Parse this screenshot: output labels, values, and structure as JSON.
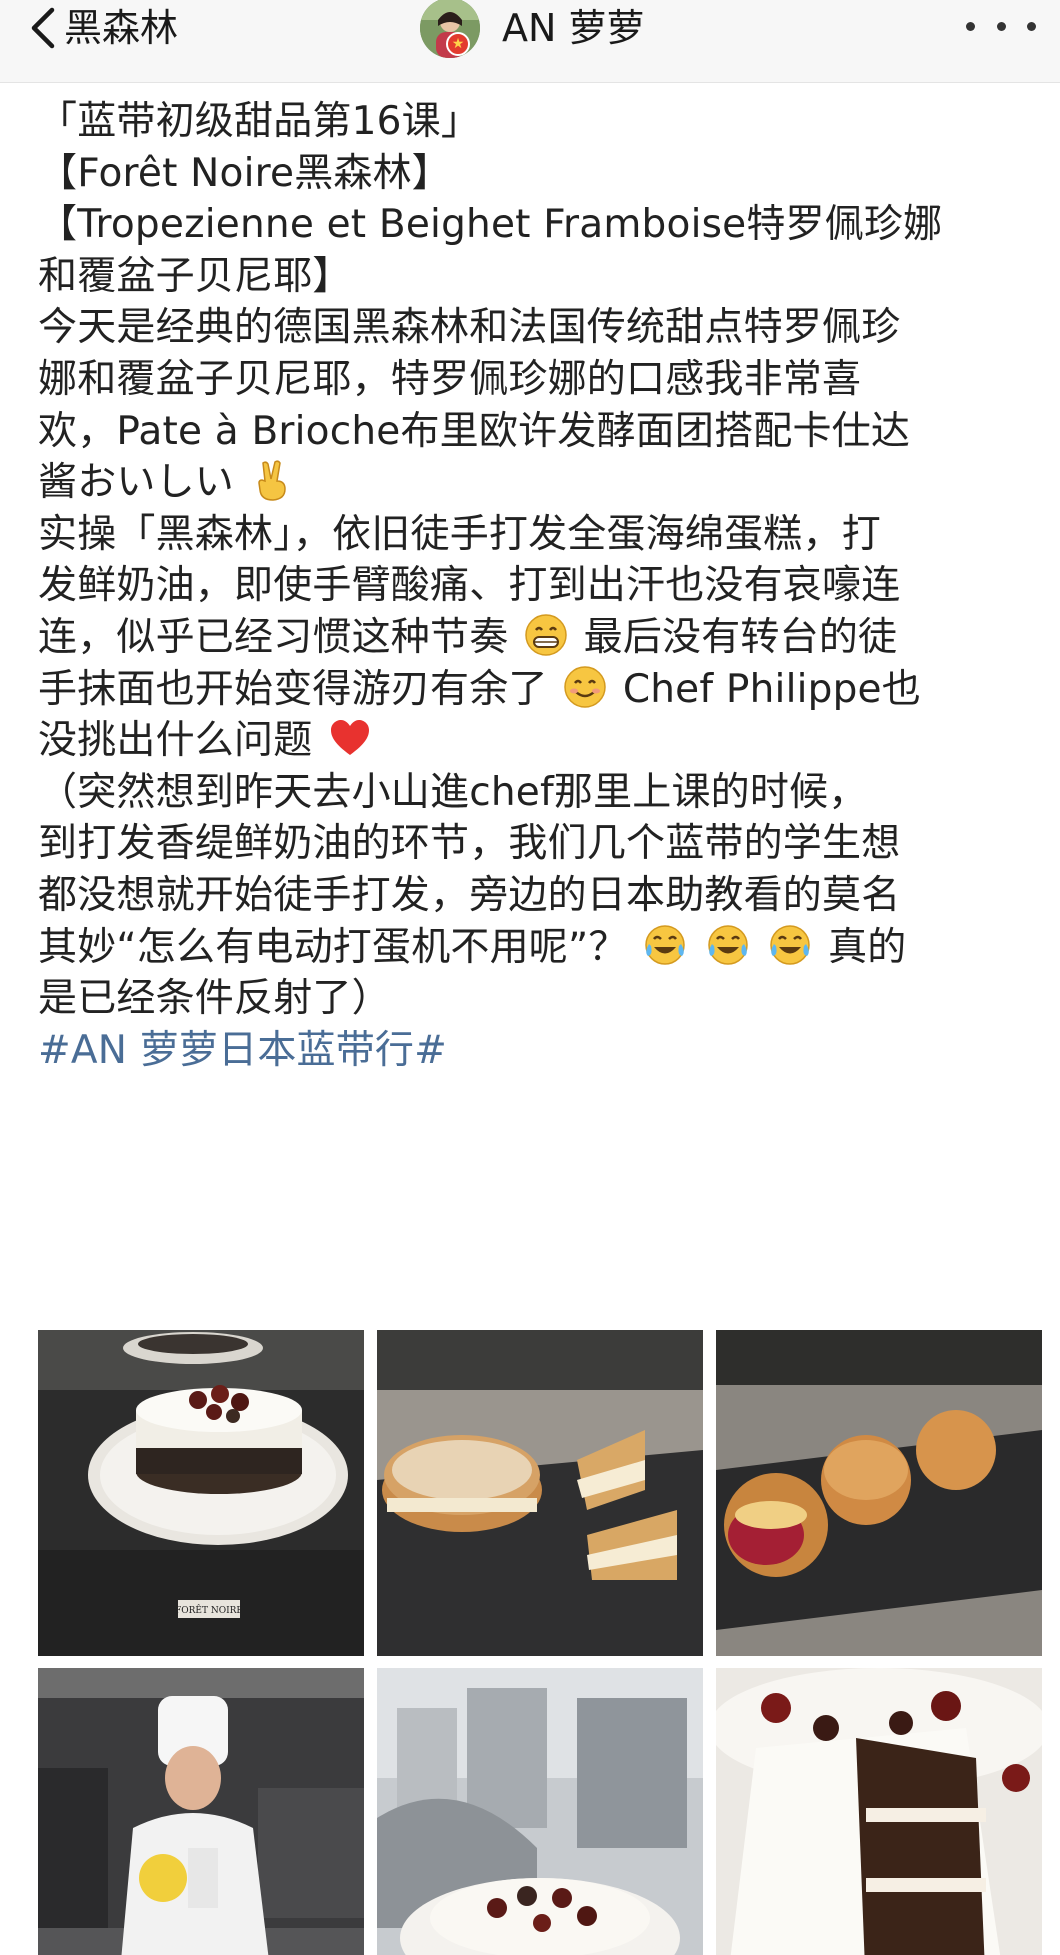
{
  "navbar": {
    "back_label": "黑森林",
    "author_name": "AN 萝萝",
    "icons": {
      "back": "chevron-left-icon",
      "more": "more-dots-icon"
    }
  },
  "post": {
    "lines": {
      "l1": "「蓝带初级甜品第16课」",
      "l2": "【Forêt Noire黑森林】",
      "l3": "【Tropezienne et Beighet Framboise特罗佩珍娜",
      "l4": "和覆盆子贝尼耶】",
      "l5": "今天是经典的德国黑森林和法国传统甜点特罗佩珍",
      "l6": "娜和覆盆子贝尼耶，特罗佩珍娜的口感我非常喜",
      "l7": "欢，Pate à Brioche布里欧许发酵面团搭配卡仕达",
      "l8": "酱おいしい",
      "l9": "实操「黑森林」，依旧徒手打发全蛋海绵蛋糕，打",
      "l10": "发鲜奶油，即使手臂酸痛、打到出汗也没有哀嚎连",
      "l11a": "连，似乎已经习惯这种节奏",
      "l11b": "最后没有转台的徒",
      "l12a": "手抹面也开始变得游刃有余了",
      "l12b": "Chef Philippe也",
      "l13": "没挑出什么问题",
      "l14": "（突然想到昨天去小山進chef那里上课的时候，",
      "l15": "到打发香缇鲜奶油的环节，我们几个蓝带的学生想",
      "l16": "都没想就开始徒手打发，旁边的日本助教看的莫名",
      "l17a": "其妙“怎么有电动打蛋机不用呢”？",
      "l17b": "真的",
      "l18": "是已经条件反射了）"
    },
    "hashtag": "#AN 萝萝日本蓝带行#",
    "emojis": {
      "victory": "victory-hand-emoji",
      "grin": "grinning-face-emoji",
      "smile": "smiling-face-emoji",
      "heart": "red-heart-emoji",
      "laugh": "tears-of-joy-emoji"
    }
  },
  "photos": {
    "p1_label": "FORÊT NOIRE"
  },
  "colors": {
    "hashtag": "#4a6d96",
    "text": "#222222",
    "navbar_bg": "#f7f7f7"
  }
}
